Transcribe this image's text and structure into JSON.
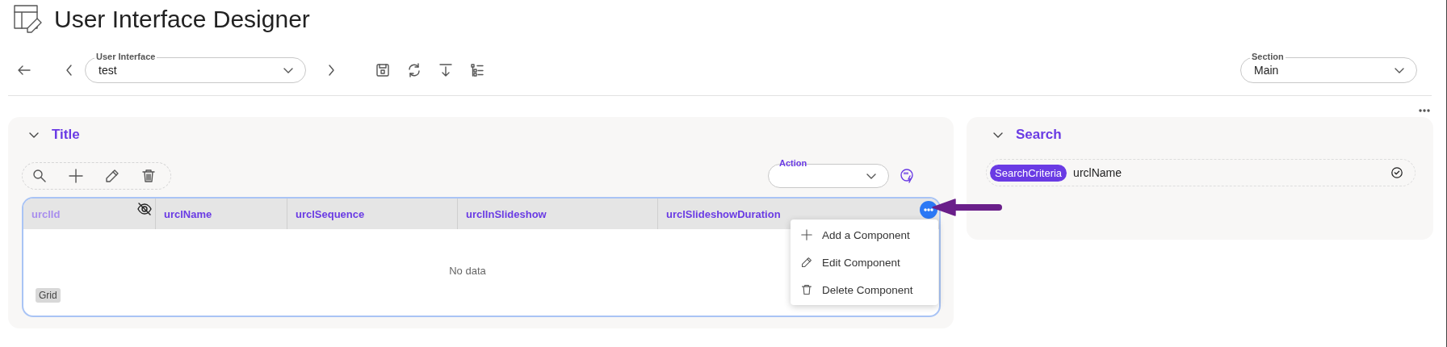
{
  "page": {
    "title": "User Interface Designer"
  },
  "toolbar": {
    "user_interface": {
      "label": "User Interface",
      "value": "test"
    },
    "section": {
      "label": "Section",
      "value": "Main"
    }
  },
  "title_panel": {
    "title": "Title",
    "expanded": true,
    "action": {
      "label": "Action"
    },
    "grid": {
      "columns": [
        {
          "label": "urclId",
          "hidden": true
        },
        {
          "label": "urclName",
          "hidden": false
        },
        {
          "label": "urclSequence",
          "hidden": false
        },
        {
          "label": "urclInSlideshow",
          "hidden": false
        },
        {
          "label": "urclSlideshowDuration",
          "hidden": false
        }
      ],
      "empty_text": "No data",
      "badge": "Grid",
      "menu": [
        {
          "kind": "add",
          "label": "Add a Component"
        },
        {
          "kind": "edit",
          "label": "Edit Component"
        },
        {
          "kind": "delete",
          "label": "Delete Component"
        }
      ]
    }
  },
  "search_panel": {
    "title": "Search",
    "expanded": true,
    "chip": "SearchCriteria",
    "value": "urclName"
  }
}
